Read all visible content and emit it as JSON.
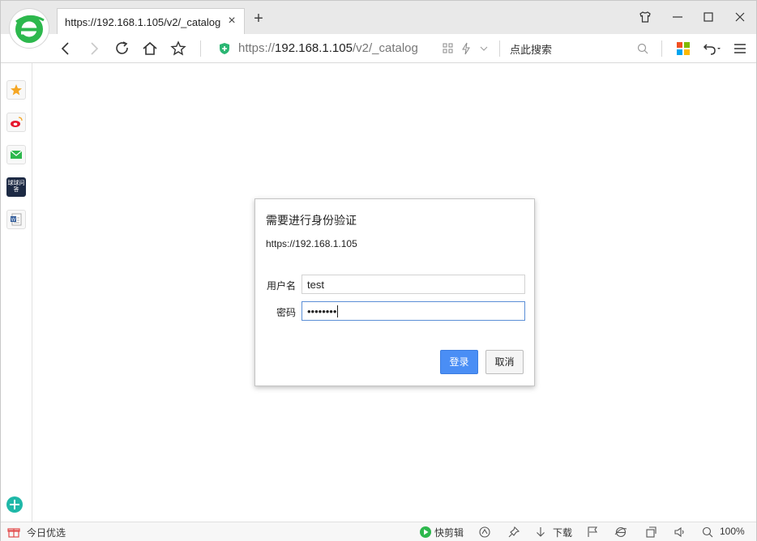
{
  "window": {
    "tab_title": "https://192.168.1.105/v2/_catalog",
    "tab_close": "×",
    "new_tab": "+"
  },
  "address": {
    "url_prefix": "https://",
    "url_host": "192.168.1.105",
    "url_path": "/v2/_catalog",
    "search_placeholder": "点此搜索"
  },
  "sidebar": {
    "items": [
      {
        "name": "favorites",
        "icon": "star-icon"
      },
      {
        "name": "weibo",
        "icon": "weibo-icon"
      },
      {
        "name": "mail",
        "icon": "mail-icon"
      },
      {
        "name": "qiuqiu",
        "icon": "qiuqiu-icon",
        "label": "球球问答"
      },
      {
        "name": "word",
        "icon": "word-icon"
      }
    ]
  },
  "dialog": {
    "title": "需要进行身份验证",
    "host": "https://192.168.1.105",
    "username_label": "用户名",
    "username_value": "test",
    "password_label": "密码",
    "password_mask": "••••••••",
    "login_button": "登录",
    "cancel_button": "取消"
  },
  "statusbar": {
    "today_label": "今日优选",
    "clip_label": "快剪辑",
    "download_label": "下载",
    "zoom": "100%"
  },
  "colors": {
    "accent": "#4a8ef5",
    "logo_green": "#2db84d",
    "shield_green": "#2bb673"
  }
}
